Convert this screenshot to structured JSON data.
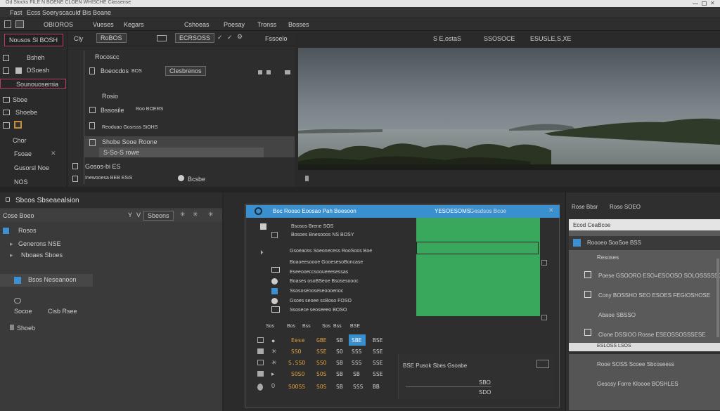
{
  "titlebar": {
    "title": "Od Stocks FILE N BOENE CLOEN WHISCHE Classense"
  },
  "menubar": {
    "items": [
      "Fast",
      "Ecss Soery",
      "scaculo",
      "f Bis Boane"
    ]
  },
  "toolbar": {
    "left_items": [
      "OBIOROS",
      "Vueses",
      "Kegars",
      "Cshoeas",
      "Poesay",
      "Tronss",
      "Bosses"
    ],
    "right_items": [
      "Cly",
      "RoBOS",
      "ECRSOSS",
      "Fssoelo"
    ],
    "status": [
      "S E,ostaS",
      "SSOSOCE",
      "ESUSLE,S,XE"
    ]
  },
  "leftbar": {
    "project_label": "Nousos Sl BOSH",
    "items": [
      "Bsheh",
      "DSoesh",
      "Sounouosemia",
      "Sboe",
      "Shoebe",
      "Chor",
      "Fsoae",
      "Gusorsl Noe",
      "NOS"
    ]
  },
  "browser": {
    "header": "Rocoscc",
    "rows": [
      "Boeocdos",
      "Rosio",
      "Bssosile",
      "Reoduao Gosrsss SiOHS",
      "Shobe Sooe Roone",
      "S-So-S rowe",
      "Gosos-bi ES",
      "Inewooesa BEB ESiS"
    ],
    "filter_button": "Clesbrenos",
    "col2": [
      "BOS",
      "Roo BOERS"
    ],
    "footer_btn": "Bcsbe"
  },
  "viewer": {
    "caption": "Scenic lake with forested hills under overcast sky"
  },
  "project_panel": {
    "title": "Sbcos Sbseaealsion",
    "search": "Cose Boeo",
    "search_right": "Sbeons",
    "items": [
      "Rosos",
      "Generons NSE",
      "Nboaes Sboes",
      "Bsos Neseanoon",
      "Socoe",
      "Cisb Rsee",
      "Shoeb"
    ]
  },
  "timeline": {
    "header": "Boc Rooso Eoosao Pah Boesoon",
    "header_right": "YESOESOMS",
    "header_far": "Gesdsos Bcoe",
    "tracks": [
      "Bsosos Brene SOS",
      "Bosoes Bnesooos NS BOSY",
      "Gsoeaoss Soeonecess RooSoos Boe",
      "Boaoeesoooe GooesesoBoncase",
      "Eseeooeccsooueeesessas",
      "Boases osoBSeoe Bsosesoooc",
      "Ssososenoseseoooenoc",
      "Gsoes seoee scBoso FOSO",
      "Ssosece seoseeeo BOSO"
    ],
    "counters_header": [
      "Sos",
      "Bos",
      "Bss",
      "Sos",
      "Bss",
      "BSE"
    ],
    "counter_rows": [
      [
        "Eese",
        "GBE",
        "SB",
        "SBE",
        "BSE"
      ],
      [
        "SSO",
        "SSE",
        "SO",
        "SSS",
        "SSE"
      ],
      [
        "S.SSO",
        "SSO",
        "SB",
        "SSS",
        "SSE"
      ],
      [
        "SOSO",
        "SOS",
        "SB",
        "SB",
        "SSE"
      ],
      [
        "SOOSS",
        "SOS",
        "SB",
        "SSS",
        "BB"
      ]
    ],
    "status_box": "BSE Pusok Sbes Gsoabe",
    "status_val": "SBO",
    "status_val2": "SDO"
  },
  "inspector": {
    "tabs": [
      "Rose Bbsr",
      "Roso SOEO"
    ],
    "header": "Ecod CeaBcoe",
    "selected": "Roooeo SooSoe BSS",
    "sub": "Resoses",
    "rows": [
      "Poese GSOORO ESO=ESOOSO SOLOSSSSSO",
      "Cony BOSSHO SEO ESOES FEGIOSHOSE",
      "Abaoe SBSSO",
      "Clone DSSIOO Rosse ESEOSSOSSSESE"
    ],
    "bar": "ESLOSS LSOS",
    "bottom": [
      "Rooe SOSS Scoee Sbcoseess",
      "Gesosy Forre Kloooe BOSHLES"
    ]
  }
}
